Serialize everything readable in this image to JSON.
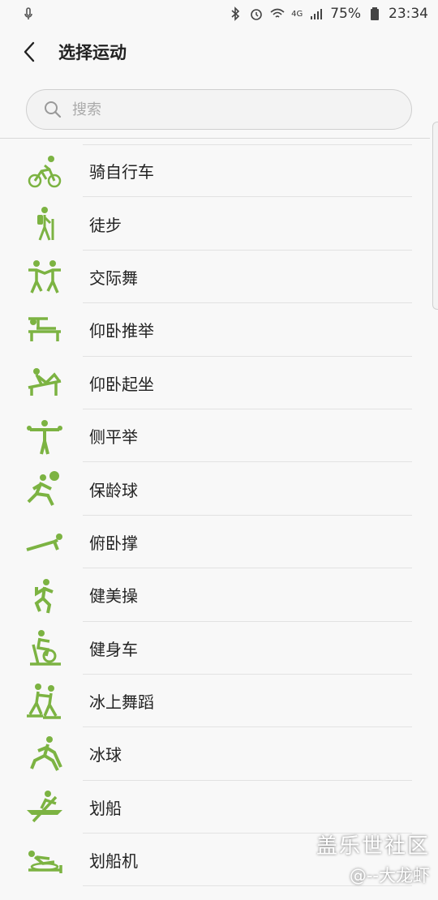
{
  "status": {
    "time": "23:34",
    "battery": "75%",
    "network": "4G",
    "icons": [
      "mic-icon",
      "bluetooth-icon",
      "alarm-icon",
      "wifi-icon",
      "signal-icon",
      "battery-icon"
    ]
  },
  "header": {
    "back_icon": "back-arrow-icon",
    "title": "选择运动"
  },
  "search": {
    "placeholder": "搜索",
    "value": "",
    "icon": "search-icon"
  },
  "accent_color": "#7cb342",
  "sports": [
    {
      "label": "骑自行车",
      "icon": "cycling-icon"
    },
    {
      "label": "徒步",
      "icon": "hiking-icon"
    },
    {
      "label": "交际舞",
      "icon": "dance-icon"
    },
    {
      "label": "仰卧推举",
      "icon": "bench-press-icon"
    },
    {
      "label": "仰卧起坐",
      "icon": "sit-up-icon"
    },
    {
      "label": "侧平举",
      "icon": "lateral-raise-icon"
    },
    {
      "label": "保龄球",
      "icon": "bowling-icon"
    },
    {
      "label": "俯卧撑",
      "icon": "push-up-icon"
    },
    {
      "label": "健美操",
      "icon": "aerobics-icon"
    },
    {
      "label": "健身车",
      "icon": "exercise-bike-icon"
    },
    {
      "label": "冰上舞蹈",
      "icon": "ice-dance-icon"
    },
    {
      "label": "冰球",
      "icon": "ice-hockey-icon"
    },
    {
      "label": "划船",
      "icon": "rowing-icon"
    },
    {
      "label": "划船机",
      "icon": "rowing-machine-icon"
    }
  ],
  "watermark": {
    "logo": "盖乐世社区",
    "user": "@--大龙虾"
  }
}
